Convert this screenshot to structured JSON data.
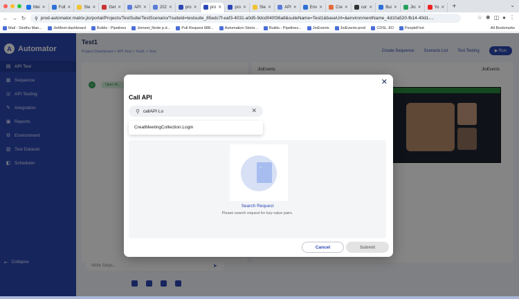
{
  "browser": {
    "tabs": [
      {
        "label": "Mei",
        "color": "#1a73e8"
      },
      {
        "label": "Full",
        "color": "#2d6fd6"
      },
      {
        "label": "Ste",
        "color": "#f1c232"
      },
      {
        "label": "Get",
        "color": "#c33"
      },
      {
        "label": "API",
        "color": "#5b7bd8"
      },
      {
        "label": "202",
        "color": "#5b7bd8"
      },
      {
        "label": "pro",
        "color": "#2c47b3"
      },
      {
        "label": "pro",
        "color": "#2c47b3",
        "active": true
      },
      {
        "label": "pro",
        "color": "#2c47b3"
      },
      {
        "label": "Ste",
        "color": "#f1c232"
      },
      {
        "label": "API",
        "color": "#5b7bd8"
      },
      {
        "label": "Env",
        "color": "#2d6fd6"
      },
      {
        "label": "Cre",
        "color": "#e36c3c"
      },
      {
        "label": "cor",
        "color": "#333"
      },
      {
        "label": "Bui",
        "color": "#2d6fd6"
      },
      {
        "label": "Jio",
        "color": "#29a05a"
      },
      {
        "label": "Yo",
        "color": "#e22"
      }
    ],
    "url": "prod-automator.matrix.jio/portal/Projects/TestSuite/TestScenario/?suiteId=testsuite_85edc7f-eaf3-4031-a0d5-9dcd040f36a8&suiteName=Test1&baseUrl=&environmentName_4d10a520-fb14-40d1-...",
    "bookmarks": [
      "Mail - Sindhu Man...",
      "JioMeet-dashboard",
      "Builds - Pipelines",
      "Jomeet_Node p.d...",
      "Pull Request 888...",
      "Automation Storie...",
      "Builds - Pipelines...",
      "JioEvents",
      "JioEvents-prod",
      "CDSL JIO",
      "PeopleFirst"
    ],
    "all_bookmarks": "All Bookmarks"
  },
  "app": {
    "name": "Automator",
    "sidebar": [
      {
        "label": "API Test",
        "icon": "api-icon",
        "glyph": "▤",
        "active": true
      },
      {
        "label": "Sequence",
        "icon": "sequence-icon",
        "glyph": "▦"
      },
      {
        "label": "API Testing",
        "icon": "testing-icon",
        "glyph": "◎"
      },
      {
        "label": "Integration",
        "icon": "integration-icon",
        "glyph": "✎"
      },
      {
        "label": "Reports",
        "icon": "reports-icon",
        "glyph": "▣"
      },
      {
        "label": "Environment",
        "icon": "environment-icon",
        "glyph": "⚙"
      },
      {
        "label": "Test Dataset",
        "icon": "dataset-icon",
        "glyph": "▥"
      },
      {
        "label": "Scheduler",
        "icon": "scheduler-icon",
        "glyph": "◧"
      }
    ],
    "collapse": "Collapse",
    "page_title": "Test1",
    "breadcrumb": "Project Dashboard  >  API Test  >  Test1  >  Test",
    "top_actions": {
      "create_sequence": "Create Sequence",
      "scenario_list": "Scenario List",
      "test_testing": "Test Testing",
      "run": "Run"
    },
    "step_label": "Open W...",
    "right_pane_title": "JioEvents",
    "env_select": "JioEvents",
    "ask_placeholder": "Write Steps..."
  },
  "modal": {
    "title": "Call API",
    "search_value": "callAPI Lo",
    "suggestion": "CreatMeetingCollection.Login",
    "empty_title": "Search Request",
    "empty_sub": "Please search request for key-value pairs.",
    "cancel": "Cancel",
    "submit": "Submit"
  }
}
